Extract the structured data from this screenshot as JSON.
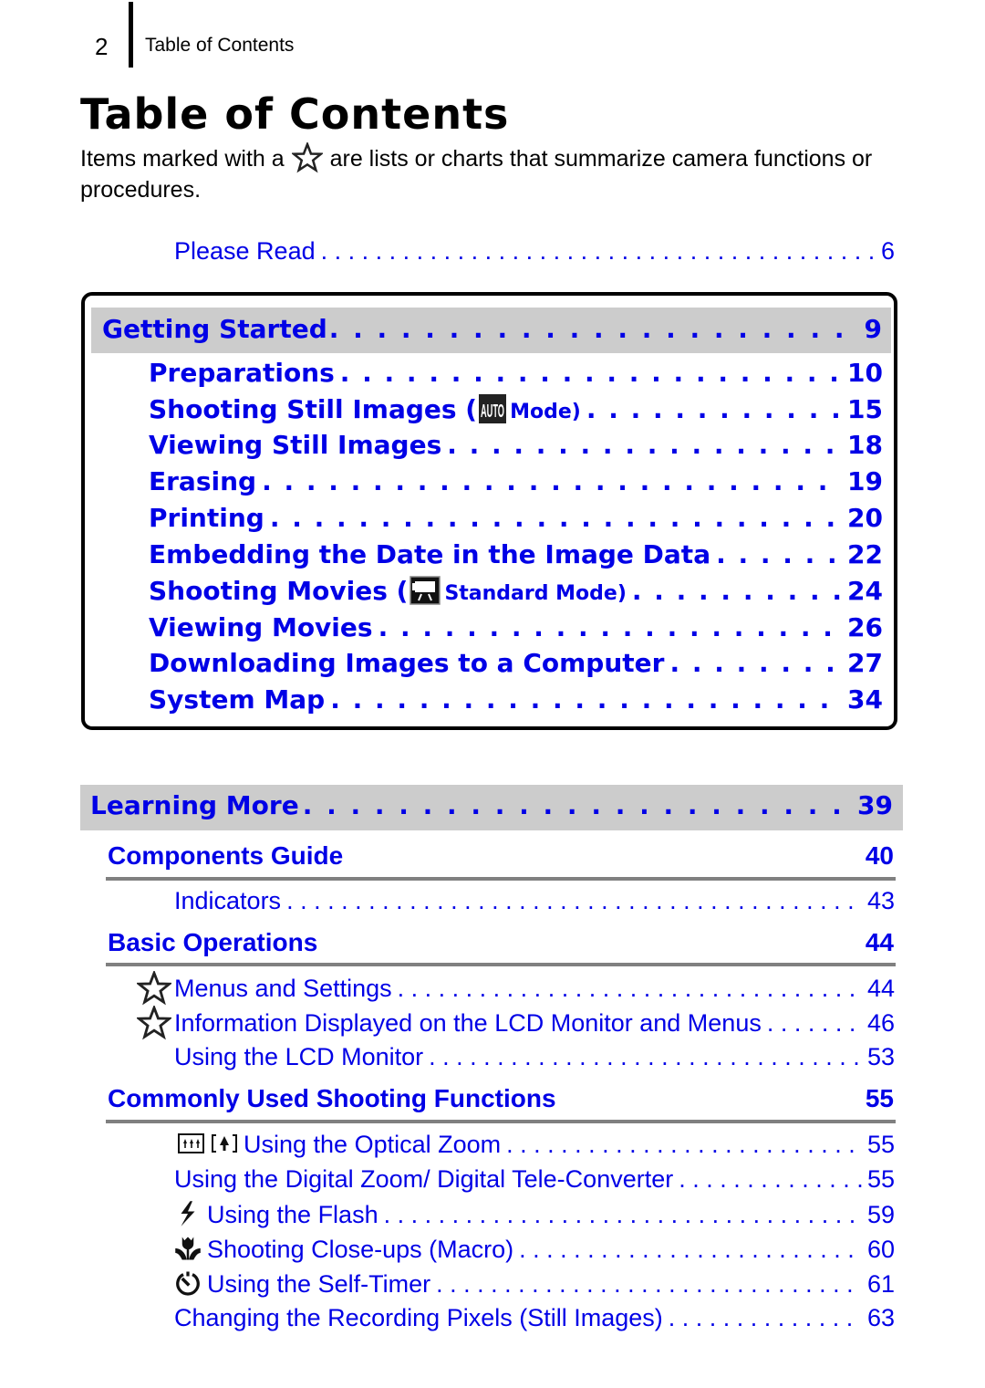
{
  "header": {
    "page_number": "2",
    "section": "Table of Contents"
  },
  "title": "Table of Contents",
  "intro": {
    "before_icon": "Items marked with a",
    "icon": "star-icon",
    "after_icon": "are lists or charts that summarize camera functions or procedures."
  },
  "please_read": {
    "label": "Please Read",
    "page": "6"
  },
  "getting_started": {
    "heading": "Getting Started",
    "page": "9",
    "items": [
      {
        "label": "Preparations",
        "page": "10"
      },
      {
        "label": "Shooting Still Images (",
        "icon": "auto-mode-icon",
        "suffix": "Mode)",
        "page": "15"
      },
      {
        "label": "Viewing Still Images",
        "page": "18"
      },
      {
        "label": "Erasing",
        "page": "19"
      },
      {
        "label": "Printing",
        "page": "20"
      },
      {
        "label": "Embedding the Date in the Image Data",
        "page": "22"
      },
      {
        "label": "Shooting Movies (",
        "icon": "movie-mode-icon",
        "suffix": "Standard Mode)",
        "page": "24"
      },
      {
        "label": "Viewing Movies",
        "page": "26"
      },
      {
        "label": "Downloading Images to a Computer",
        "page": "27"
      },
      {
        "label": "System Map",
        "page": "34"
      }
    ]
  },
  "learning_more": {
    "heading": "Learning More",
    "page": "39",
    "sections": [
      {
        "heading": "Components Guide",
        "page": "40",
        "items": [
          {
            "label": "Indicators",
            "page": "43"
          }
        ]
      },
      {
        "heading": "Basic Operations",
        "page": "44",
        "items": [
          {
            "label": "Menus and Settings",
            "page": "44",
            "icon": "star-icon"
          },
          {
            "label": "Information Displayed on the LCD Monitor and Menus",
            "page": "46",
            "icon": "star-icon"
          },
          {
            "label": "Using the LCD Monitor",
            "page": "53"
          }
        ]
      },
      {
        "heading": "Commonly Used Shooting Functions",
        "page": "55",
        "items": [
          {
            "label": "Using the Optical Zoom",
            "page": "55",
            "icon": "telephoto-wide-icon"
          },
          {
            "label": "Using the Digital Zoom/ Digital Tele-Converter",
            "page": "55"
          },
          {
            "label": "Using the Flash",
            "page": "59",
            "icon": "flash-icon"
          },
          {
            "label": "Shooting Close-ups (Macro)",
            "page": "60",
            "icon": "macro-icon"
          },
          {
            "label": "Using the Self-Timer",
            "page": "61",
            "icon": "self-timer-icon"
          },
          {
            "label": "Changing the Recording Pixels (Still Images)",
            "page": "63"
          }
        ]
      }
    ]
  },
  "colors": {
    "link": "#0000e6",
    "band": "#cccccc",
    "rule": "#808080"
  }
}
